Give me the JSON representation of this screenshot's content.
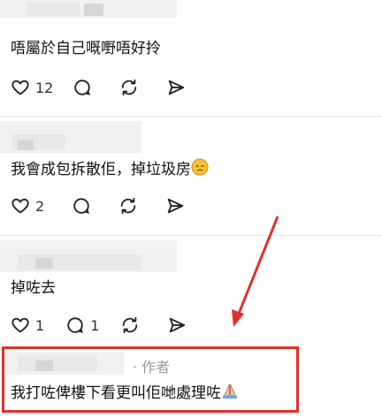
{
  "comments": [
    {
      "text": "唔屬於自己嘅嘢唔好拎",
      "likes": "12"
    },
    {
      "text": "我會成包拆散佢，掉垃圾房",
      "likes": "2"
    },
    {
      "text": "掉咗去",
      "likes": "1",
      "replies": "1"
    },
    {
      "author_tag": "· 作者",
      "text": "我打咗俾樓下看更叫佢哋處理咗"
    }
  ]
}
